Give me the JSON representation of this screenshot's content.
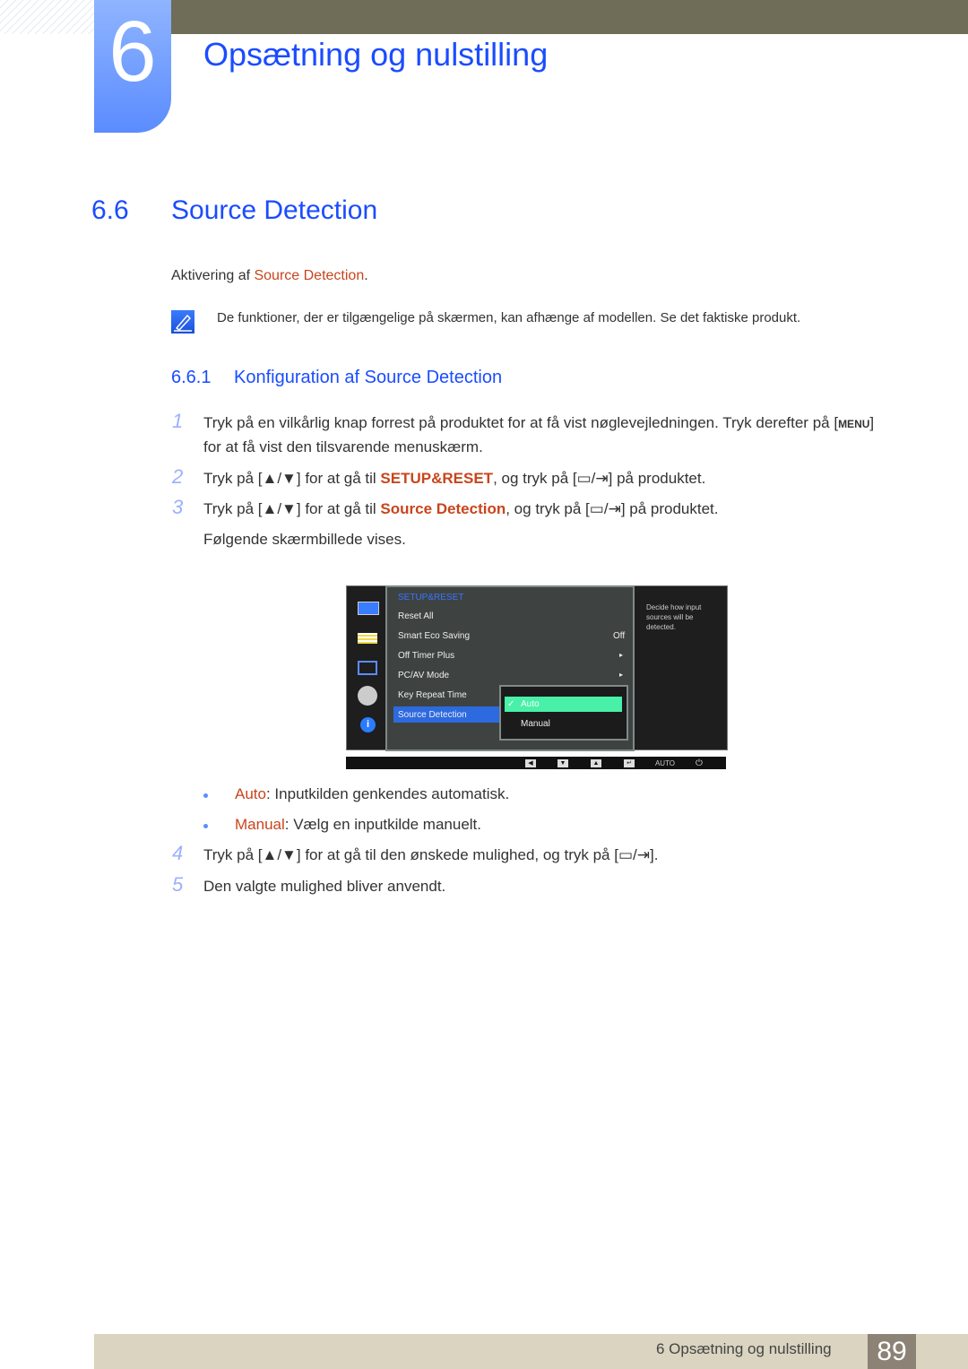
{
  "header": {
    "chapter_number": "6",
    "chapter_title": "Opsætning og nulstilling"
  },
  "section": {
    "number": "6.6",
    "title": "Source Detection",
    "intro_prefix": "Aktivering af ",
    "intro_highlight": "Source Detection",
    "intro_suffix": ".",
    "note_icon": "note-pencil-icon",
    "note": "De funktioner, der er tilgængelige på skærmen, kan afhænge af modellen. Se det faktiske produkt."
  },
  "subsection": {
    "number": "6.6.1",
    "title": "Konfiguration af Source Detection"
  },
  "steps": [
    {
      "num": "1",
      "line1": "Tryk på en vilkårlig knap forrest på produktet for at få vist nøglevejledningen. Tryk derefter på [",
      "key": "MENU",
      "line1_end": "]",
      "line2": "for at få vist den tilsvarende menuskærm."
    },
    {
      "num": "2",
      "pre": "Tryk på [▲/▼] for at gå til ",
      "hl": "SETUP&RESET",
      "post": ", og tryk på [",
      "keys": "▭/⇥",
      "end": "] på produktet."
    },
    {
      "num": "3",
      "pre": "Tryk på [▲/▼] for at gå til ",
      "hl": "Source Detection",
      "post": ", og tryk på [",
      "keys": "▭/⇥",
      "end": "] på produktet.",
      "after": "Følgende skærmbillede vises."
    },
    {
      "num": "4",
      "pre": "Tryk på [▲/▼] for at gå til den ønskede mulighed, og tryk på [",
      "keys": "▭/⇥",
      "end": "]."
    },
    {
      "num": "5",
      "text": "Den valgte mulighed bliver anvendt."
    }
  ],
  "osd": {
    "header": "SETUP&RESET",
    "items": [
      {
        "label": "Reset All",
        "value": ""
      },
      {
        "label": "Smart Eco Saving",
        "value": "Off"
      },
      {
        "label": "Off Timer Plus",
        "value": "▸"
      },
      {
        "label": "PC/AV Mode",
        "value": "▸"
      },
      {
        "label": "Key Repeat Time",
        "value": ""
      },
      {
        "label": "Source Detection",
        "value": ""
      }
    ],
    "submenu": [
      {
        "label": "Auto",
        "selected": true
      },
      {
        "label": "Manual",
        "selected": false
      }
    ],
    "help": "Decide how input sources will be detected.",
    "buttons": [
      "◀",
      "▼",
      "▲",
      "↵",
      "AUTO",
      "⏻"
    ]
  },
  "options": [
    {
      "name": "Auto",
      "desc": ": Inputkilden genkendes automatisk."
    },
    {
      "name": "Manual",
      "desc": ": Vælg en inputkilde manuelt."
    }
  ],
  "footer": {
    "label": "6 Opsætning og nulstilling",
    "page": "89"
  }
}
